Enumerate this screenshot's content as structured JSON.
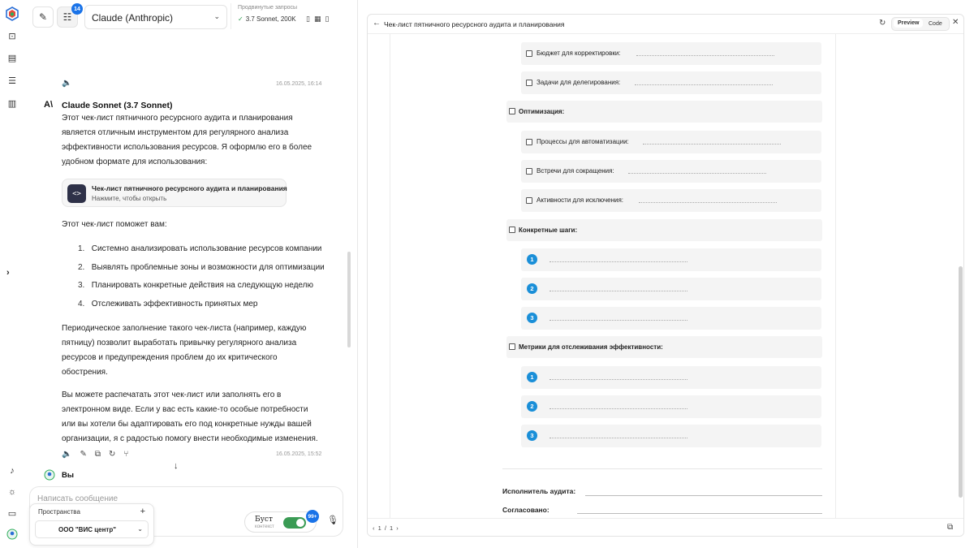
{
  "topbar": {
    "counter_badge": "14",
    "model": "Claude (Anthropic)",
    "advanced_label": "Продвинутые запросы",
    "advanced_value": "3.7 Sonnet, 200K"
  },
  "messages": {
    "first_timestamp": "16.05.2025, 16:14",
    "author": "Claude Sonnet (3.7 Sonnet)",
    "intro": "Этот чек-лист пятничного ресурсного аудита и планирования является отличным инструментом для регулярного анализа эффективности использования ресурсов. Я оформлю его в более удобном формате для использования:",
    "artifact_title": "Чек-лист пятничного ресурсного аудита и планирования",
    "artifact_hint": "Нажмите, чтобы открыть",
    "list_intro": "Этот чек-лист поможет вам:",
    "list": [
      {
        "n": "1.",
        "text": "Системно анализировать использование ресурсов компании"
      },
      {
        "n": "2.",
        "text": "Выявлять проблемные зоны и возможности для оптимизации"
      },
      {
        "n": "3.",
        "text": "Планировать конкретные действия на следующую неделю"
      },
      {
        "n": "4.",
        "text": "Отслеживать эффективность принятых мер"
      }
    ],
    "para2": "Периодическое заполнение такого чек-листа (например, каждую пятницу) позволит выработать привычку регулярного анализа ресурсов и предупреждения проблем до их критического обострения.",
    "para3": "Вы можете распечатать этот чек-лист или заполнять его в электронном виде. Если у вас есть какие-то особые потребности или вы хотели бы адаптировать его под конкретные нужды вашей организации, я с радостью помогу внести необходимые изменения.",
    "second_timestamp": "16.05.2025, 15:52",
    "you": "Вы"
  },
  "composer": {
    "placeholder": "Написать сообщение",
    "boost_label": "Буст",
    "boost_sub": "контекст",
    "boost_badge": "99+"
  },
  "spaces": {
    "label": "Пространства",
    "selected": "ООО \"ВИС центр\""
  },
  "panel": {
    "title": "Чек-лист пятничного ресурсного аудита и планирования",
    "tab_preview": "Preview",
    "tab_code": "Code",
    "page": "1 / 1",
    "items": {
      "budget": "Бюджет для корректировки:",
      "delegate": "Задачи для делегирования:",
      "optimization": "Оптимизация:",
      "automation": "Процессы для автоматизации:",
      "meetings": "Встречи для сокращения:",
      "activities": "Активности для исключения:",
      "steps": "Конкретные шаги:",
      "metrics": "Метрики для отслеживания эффективности:"
    },
    "numbers": [
      "1",
      "2",
      "3"
    ],
    "auditor": "Исполнитель аудита:",
    "approved": "Согласовано:"
  }
}
